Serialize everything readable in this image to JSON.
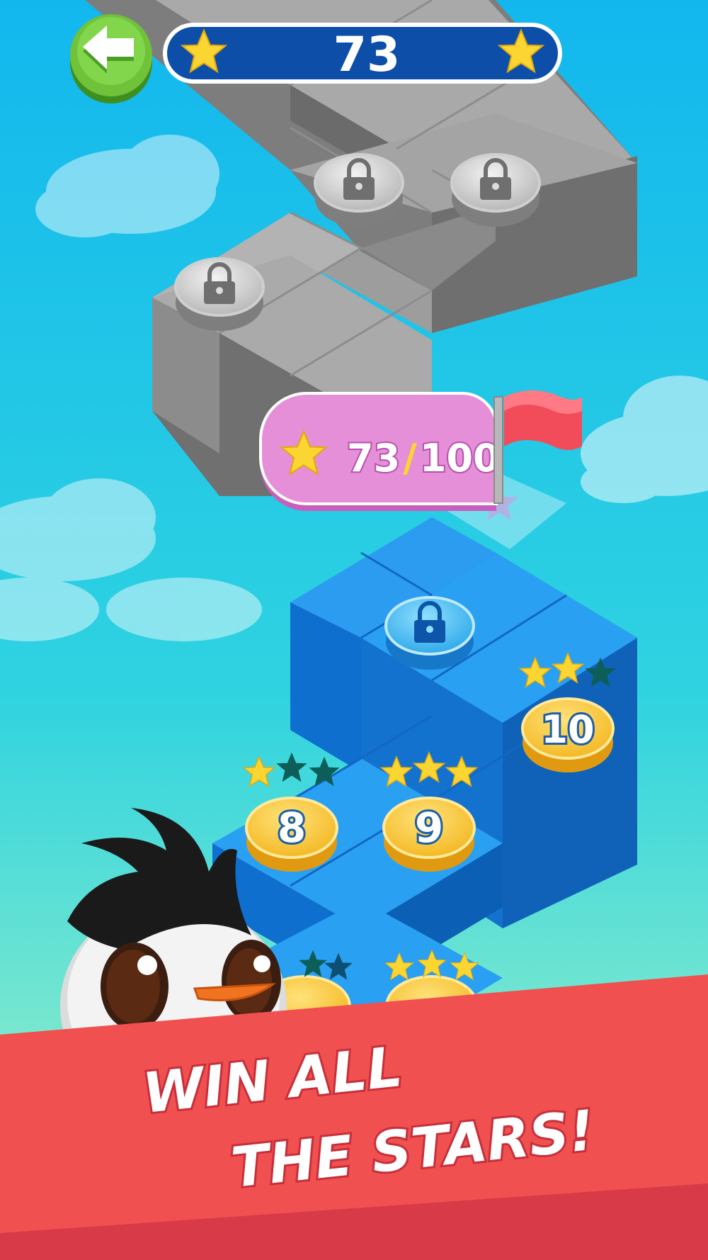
{
  "hud": {
    "back_icon": "arrow-left-icon",
    "star_count": "73"
  },
  "milestone": {
    "stars_current": "73",
    "stars_required": "100",
    "flag_icon": "red-flag-icon"
  },
  "levels": [
    {
      "number": "8",
      "stars_earned": 1,
      "stars_total": 3,
      "state": "completed"
    },
    {
      "number": "9",
      "stars_earned": 3,
      "stars_total": 3,
      "state": "completed"
    },
    {
      "number": "10",
      "stars_earned": 2,
      "stars_total": 3,
      "state": "completed"
    }
  ],
  "locked_levels": [
    {
      "zone": "blue",
      "icon": "padlock-icon"
    },
    {
      "zone": "gray",
      "icon": "padlock-icon"
    },
    {
      "zone": "gray",
      "icon": "padlock-icon"
    },
    {
      "zone": "gray",
      "icon": "padlock-icon"
    }
  ],
  "banner": {
    "line1": "WIN ALL",
    "line2": "THE STARS!"
  },
  "colors": {
    "sky_top": "#12b7ee",
    "sky_bottom": "#a8f4c4",
    "hud_bar": "#0d4fa8",
    "back_button": "#6fc23a",
    "milestone_pill": "#e58fd9",
    "banner_red": "#f0504f",
    "coin_gold": "#f7c12e",
    "star_yellow": "#fbd532",
    "star_empty": "#0d5d58"
  }
}
